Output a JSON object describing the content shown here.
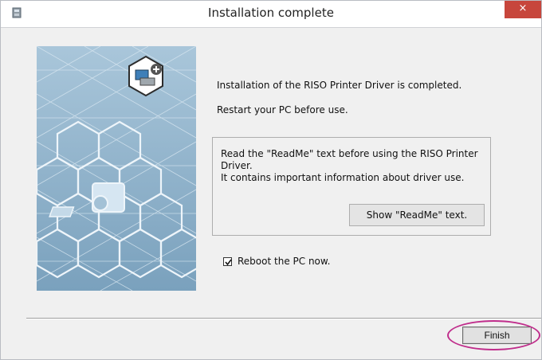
{
  "window": {
    "title": "Installation complete",
    "close_symbol": "×",
    "app_icon": "installer-icon"
  },
  "content": {
    "completed_message": "Installation of the RISO Printer Driver is completed.",
    "restart_message": "Restart your PC before use.",
    "readme_line1": "Read the \"ReadMe\" text before using the RISO Printer Driver.",
    "readme_line2": "It contains important information about driver use.",
    "readme_button_label": "Show \"ReadMe\" text.",
    "reboot_label": "Reboot the PC now.",
    "reboot_checked": true
  },
  "footer": {
    "finish_label": "Finish"
  },
  "colors": {
    "close_button": "#c7463c",
    "side_panel": "#90b3cc",
    "highlight": "#c02e8c"
  },
  "icons": [
    "installer-icon",
    "close-icon",
    "printer-add-icon",
    "printer-icon",
    "checkmark-icon"
  ]
}
